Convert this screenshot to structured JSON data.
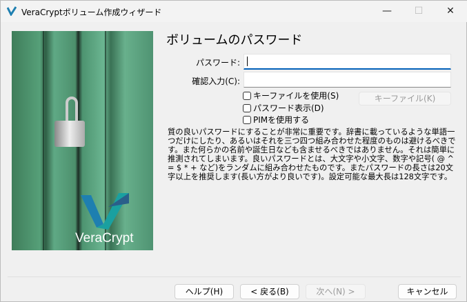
{
  "window": {
    "title": "VeraCryptボリューム作成ウィザード",
    "minimize": "—",
    "maximize": "☐",
    "close": "✕"
  },
  "logo": {
    "text": "VeraCrypt",
    "colors": [
      "#1e7fb0",
      "#1aa0a0",
      "#2a5f8a"
    ]
  },
  "heading": "ボリュームのパスワード",
  "password": {
    "label": "パスワード:",
    "value": ""
  },
  "confirm": {
    "label": "確認入力(C):",
    "value": ""
  },
  "options": [
    {
      "label": "キーファイルを使用(S)",
      "checked": false
    },
    {
      "label": "パスワード表示(D)",
      "checked": false
    },
    {
      "label": "PIMを使用する",
      "checked": false
    }
  ],
  "keyfile_button": "キーファイル(K)",
  "description": "質の良いパスワードにすることが非常に重要です。辞書に載っているような単語一つだけにしたり、あるいはそれを三つ四つ組み合わせた程度のものは避けるべきです。また何らかの名前や誕生日なども含ませるべきではありません。それは簡単に推測されてしまいます。良いパスワードとは、大文字や小文字、数字や記号( @ ^ = $ * + など)をランダムに組み合わせたものです。またパスワードの長さは20文字以上を推奨します(長い方がより良いです)。設定可能な最大長は128文字です。",
  "buttons": {
    "help": "ヘルプ(H)",
    "back": "< 戻る(B)",
    "next": "次へ(N) >",
    "cancel": "キャンセル"
  },
  "accent": "#005fb8"
}
